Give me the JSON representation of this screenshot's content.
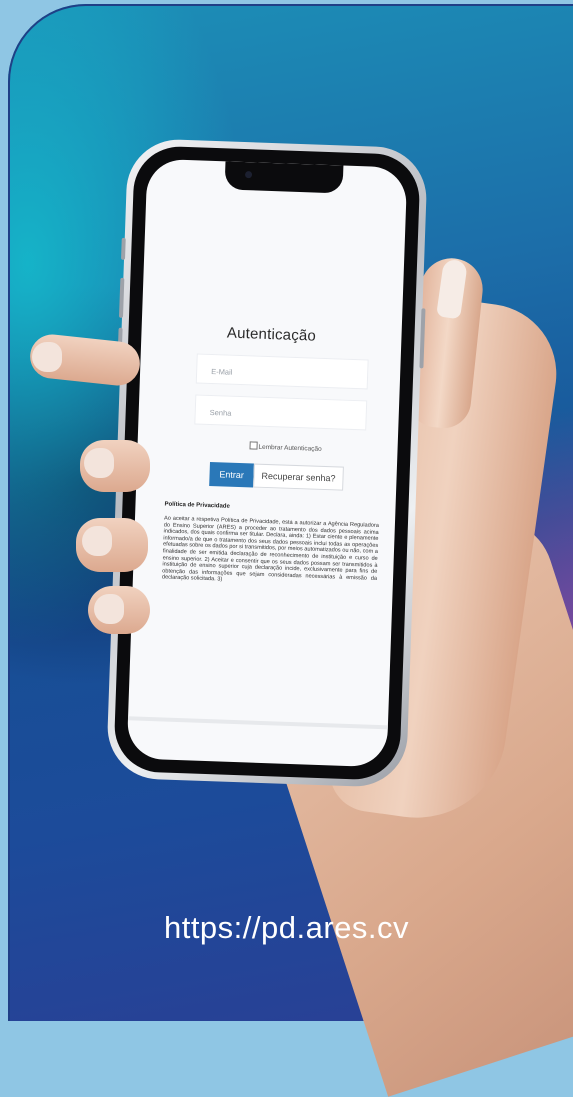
{
  "screen": {
    "title": "Autenticação",
    "email_placeholder": "E-Mail",
    "password_placeholder": "Senha",
    "remember_label": "Lembrar Autenticação",
    "enter_label": "Entrar",
    "recover_label": "Recuperar senha?",
    "policy_title": "Política de Privacidade",
    "policy_text": "Ao aceitar a respetiva Política de Privacidade, está a autorizar a Agência Reguladora do Ensino Superior (ARES) a proceder ao tratamento dos dados pessoais acima indicados, dos quais confirma ser titular. Declara, ainda: 1) Estar ciente e plenamente informado/a de que o tratamento dos seus dados pessoais inclui todas as operações efetuadas sobre os dados por si transmitidos, por meios automatizados ou não, com a finalidade de ser emitida declaração de reconhecimento de instituição e curso de ensino superior. 2) Aceitar e consentir que os seus dados possam ser transmitidos à instituição de ensino superior cuja declaração incide, exclusivamente para fins de obtenção das informações que sejam consideradas necessárias à emissão da declaração solicitada. 3)"
  },
  "url": "https://pd.ares.cv",
  "colors": {
    "primary_button": "#2a78b8",
    "card_dark": "#174f95",
    "frame_light": "#8fc6e4"
  }
}
